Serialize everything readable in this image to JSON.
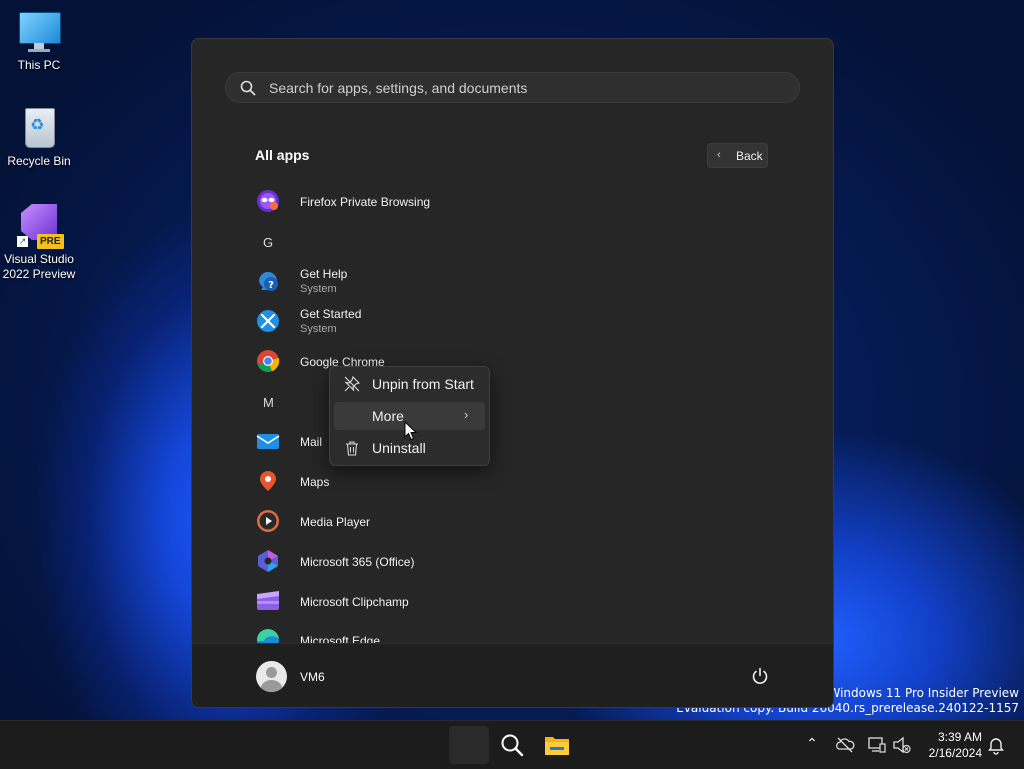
{
  "desktop": {
    "icons": [
      {
        "label": "This PC",
        "icon": "monitor-icon"
      },
      {
        "label": "Recycle Bin",
        "icon": "recycle-bin-icon"
      },
      {
        "label_line1": "Visual Studio",
        "label_line2": "2022 Preview",
        "badge": "PRE",
        "icon": "visual-studio-icon"
      }
    ]
  },
  "start_menu": {
    "search_placeholder": "Search for apps, settings, and documents",
    "section_title": "All apps",
    "back_label": "Back",
    "apps": [
      {
        "name": "Firefox Private Browsing",
        "icon": "firefox-private-icon"
      },
      {
        "letter": "G"
      },
      {
        "name": "Get Help",
        "sub": "System",
        "icon": "get-help-icon"
      },
      {
        "name": "Get Started",
        "sub": "System",
        "icon": "get-started-icon"
      },
      {
        "name": "Google Chrome",
        "icon": "chrome-icon"
      },
      {
        "letter": "M"
      },
      {
        "name": "Mail",
        "icon": "mail-icon"
      },
      {
        "name": "Maps",
        "icon": "maps-icon"
      },
      {
        "name": "Media Player",
        "icon": "media-player-icon"
      },
      {
        "name": "Microsoft 365 (Office)",
        "icon": "office-icon"
      },
      {
        "name": "Microsoft Clipchamp",
        "icon": "clipchamp-icon"
      },
      {
        "name": "Microsoft Edge",
        "icon": "edge-icon"
      }
    ],
    "user": "VM6"
  },
  "context_menu": {
    "items": [
      {
        "label": "Unpin from Start",
        "icon": "unpin-icon"
      },
      {
        "label": "More",
        "icon": "",
        "has_submenu": true
      },
      {
        "label": "Uninstall",
        "icon": "trash-icon"
      }
    ],
    "hovered": "More"
  },
  "watermark": {
    "line1": "Windows 11 Pro Insider Preview",
    "line2": "Evaluation copy. Build 26040.rs_prerelease.240122-1157"
  },
  "taskbar": {
    "time": "3:39 AM",
    "date": "2/16/2024",
    "tray_icons": [
      "chevron-up-icon",
      "onedrive-icon",
      "network-icon",
      "volume-muted-icon",
      "notification-bell-icon"
    ]
  },
  "colors": {
    "start_bg": "#262626",
    "context_bg": "#2c2c2c",
    "taskbar_bg": "#1c1c1c"
  }
}
